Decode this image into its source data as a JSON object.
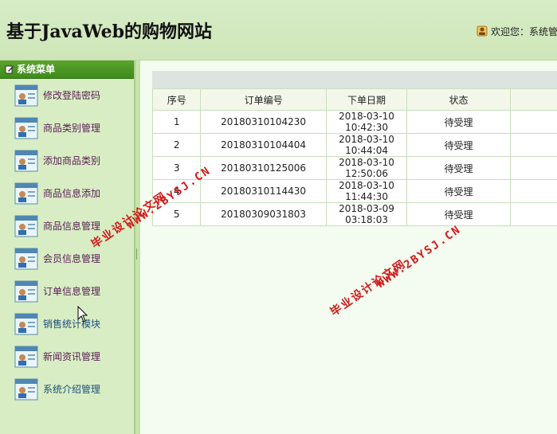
{
  "header": {
    "title": "基于JavaWeb的购物网站",
    "welcome": "欢迎您：系统管"
  },
  "sidebar": {
    "title": "系统菜单",
    "items": [
      {
        "label": "修改登陆密码"
      },
      {
        "label": "商品类别管理"
      },
      {
        "label": "添加商品类别"
      },
      {
        "label": "商品信息添加"
      },
      {
        "label": "商品信息管理"
      },
      {
        "label": "会员信息管理"
      },
      {
        "label": "订单信息管理"
      },
      {
        "label": "销售统计模块"
      },
      {
        "label": "新闻资讯管理"
      },
      {
        "label": "系统介绍管理"
      }
    ]
  },
  "table": {
    "headers": [
      "序号",
      "订单编号",
      "下单日期",
      "状态"
    ],
    "rows": [
      {
        "no": "1",
        "order_id": "20180310104230",
        "date": "2018-03-10 10:42:30",
        "status": "待受理"
      },
      {
        "no": "2",
        "order_id": "20180310104404",
        "date": "2018-03-10 10:44:04",
        "status": "待受理"
      },
      {
        "no": "3",
        "order_id": "20180310125006",
        "date": "2018-03-10 12:50:06",
        "status": "待受理"
      },
      {
        "no": "4",
        "order_id": "20180310114430",
        "date": "2018-03-10 11:44:30",
        "status": "待受理"
      },
      {
        "no": "5",
        "order_id": "20180309031803",
        "date": "2018-03-09 03:18:03",
        "status": "待受理"
      }
    ]
  },
  "watermark": {
    "cn": "毕业设计论文网",
    "url": "WWW.2BYSJ.CN"
  },
  "colors": {
    "accent_green": "#3f8b1c",
    "watermark_red": "#d21b1b"
  }
}
